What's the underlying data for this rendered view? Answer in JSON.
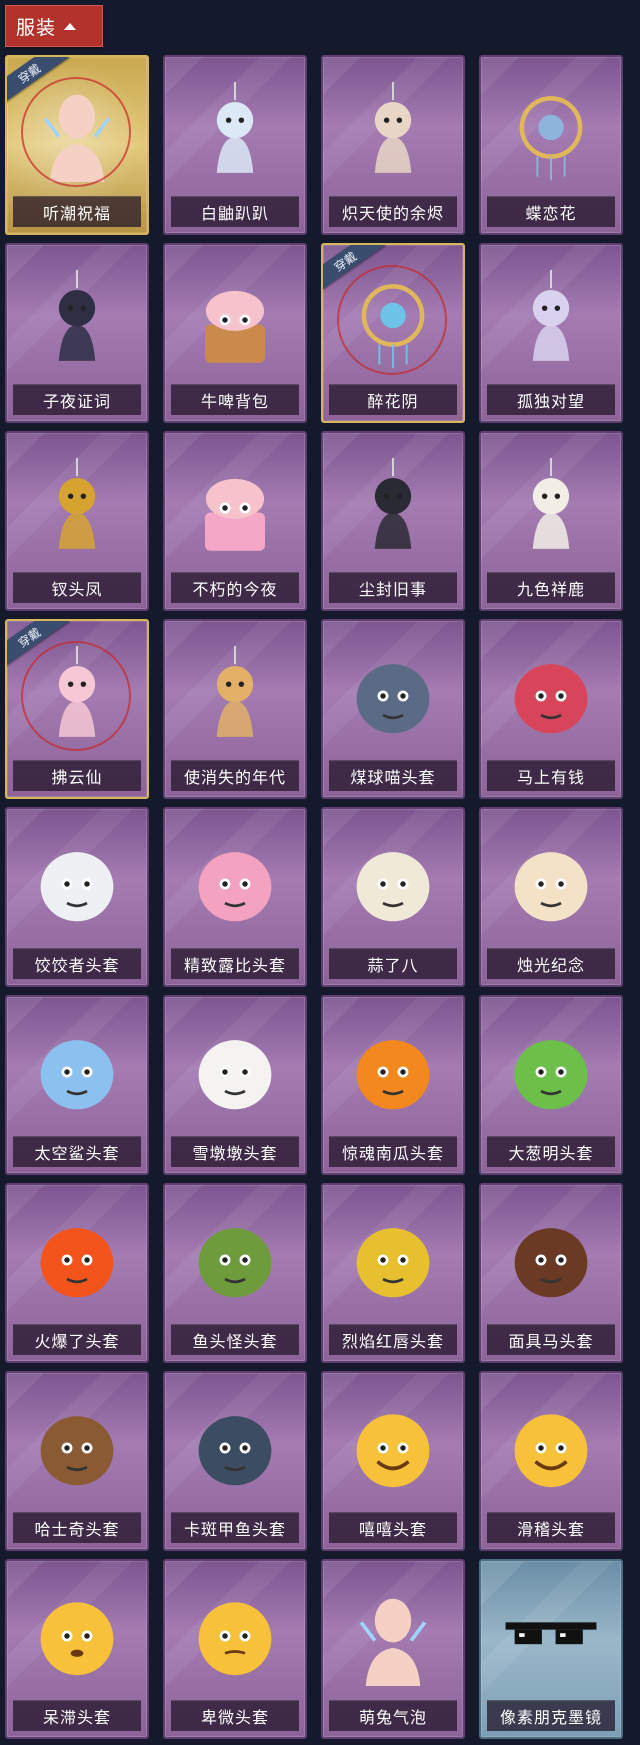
{
  "header": {
    "label": "服装"
  },
  "badge_text": "穿戴",
  "items": [
    {
      "name": "听潮祝福",
      "style": "gold",
      "equipped": true,
      "icon": "mannequin-wings-icon",
      "color": "#f4d1c4"
    },
    {
      "name": "白鼬趴趴",
      "style": "purple",
      "equipped": false,
      "icon": "white-weasel-pendant-icon",
      "color": "#dbe8f6"
    },
    {
      "name": "炽天使的余烬",
      "style": "purple",
      "equipped": false,
      "icon": "angel-doll-icon",
      "color": "#e9d6c6"
    },
    {
      "name": "蝶恋花",
      "style": "purple",
      "equipped": false,
      "icon": "butterfly-wreath-icon",
      "color": "#8fb4dc"
    },
    {
      "name": "子夜证词",
      "style": "purple",
      "equipped": false,
      "icon": "crow-doll-icon",
      "color": "#2e2f45"
    },
    {
      "name": "牛啤背包",
      "style": "purple",
      "equipped": false,
      "icon": "cow-beer-mug-icon",
      "color": "#c98a4b"
    },
    {
      "name": "醉花阴",
      "style": "purple",
      "equipped": true,
      "icon": "flower-dreamcatcher-icon",
      "color": "#6ec3e8"
    },
    {
      "name": "孤独对望",
      "style": "purple",
      "equipped": false,
      "icon": "moon-doll-icon",
      "color": "#d9d2ee"
    },
    {
      "name": "钗头凤",
      "style": "purple",
      "equipped": false,
      "icon": "phoenix-crown-doll-icon",
      "color": "#d6a331"
    },
    {
      "name": "不朽的今夜",
      "style": "purple",
      "equipped": false,
      "icon": "pink-fox-sundae-icon",
      "color": "#f4a7c7"
    },
    {
      "name": "尘封旧事",
      "style": "purple",
      "equipped": false,
      "icon": "gentleman-doll-icon",
      "color": "#2a2a35"
    },
    {
      "name": "九色祥鹿",
      "style": "purple",
      "equipped": false,
      "icon": "deer-charm-icon",
      "color": "#f2eee6"
    },
    {
      "name": "拂云仙",
      "style": "purple",
      "equipped": true,
      "icon": "cloud-fairy-charm-icon",
      "color": "#f6c7d4"
    },
    {
      "name": "使消失的年代",
      "style": "purple",
      "equipped": false,
      "icon": "sun-girl-doll-icon",
      "color": "#e2b067"
    },
    {
      "name": "煤球喵头套",
      "style": "purple",
      "equipped": false,
      "icon": "gray-cat-head-icon",
      "color": "#5b6b86"
    },
    {
      "name": "马上有钱",
      "style": "purple",
      "equipped": false,
      "icon": "red-horse-head-icon",
      "color": "#d8445a"
    },
    {
      "name": "饺饺者头套",
      "style": "purple",
      "equipped": false,
      "icon": "dumpling-head-icon",
      "color": "#eef0f4"
    },
    {
      "name": "精致露比头套",
      "style": "purple",
      "equipped": false,
      "icon": "pink-beaver-head-icon",
      "color": "#f3a2c0"
    },
    {
      "name": "蒜了八",
      "style": "purple",
      "equipped": false,
      "icon": "garlic-head-icon",
      "color": "#f1e9d8"
    },
    {
      "name": "烛光纪念",
      "style": "purple",
      "equipped": false,
      "icon": "candle-head-icon",
      "color": "#f4e2c6"
    },
    {
      "name": "太空鲨头套",
      "style": "purple",
      "equipped": false,
      "icon": "shark-head-icon",
      "color": "#8cc0ef"
    },
    {
      "name": "雪墩墩头套",
      "style": "purple",
      "equipped": false,
      "icon": "snowman-head-icon",
      "color": "#f5f3f2"
    },
    {
      "name": "惊魂南瓜头套",
      "style": "purple",
      "equipped": false,
      "icon": "pumpkin-head-icon",
      "color": "#f2881e"
    },
    {
      "name": "大葱明头套",
      "style": "purple",
      "equipped": false,
      "icon": "scallion-head-icon",
      "color": "#6cc04a"
    },
    {
      "name": "火爆了头套",
      "style": "purple",
      "equipped": false,
      "icon": "fire-head-icon",
      "color": "#f2541c"
    },
    {
      "name": "鱼头怪头套",
      "style": "purple",
      "equipped": false,
      "icon": "fish-head-icon",
      "color": "#6e9b3c"
    },
    {
      "name": "烈焰红唇头套",
      "style": "purple",
      "equipped": false,
      "icon": "yellow-mouse-head-icon",
      "color": "#e7c02f"
    },
    {
      "name": "面具马头套",
      "style": "purple",
      "equipped": false,
      "icon": "horse-mask-icon",
      "color": "#6a3a24"
    },
    {
      "name": "哈士奇头套",
      "style": "purple",
      "equipped": false,
      "icon": "husky-head-icon",
      "color": "#8a5a34"
    },
    {
      "name": "卡斑甲鱼头套",
      "style": "purple",
      "equipped": false,
      "icon": "whale-head-icon",
      "color": "#3c4c63"
    },
    {
      "name": "嘻嘻头套",
      "style": "purple",
      "equipped": false,
      "icon": "grin-emoji-head-icon",
      "color": "#f7c23a"
    },
    {
      "name": "滑稽头套",
      "style": "purple",
      "equipped": false,
      "icon": "smirk-emoji-head-icon",
      "color": "#f7c23a"
    },
    {
      "name": "呆滞头套",
      "style": "purple",
      "equipped": false,
      "icon": "dazed-emoji-head-icon",
      "color": "#f7c23a"
    },
    {
      "name": "卑微头套",
      "style": "purple",
      "equipped": false,
      "icon": "shy-emoji-head-icon",
      "color": "#f7c23a"
    },
    {
      "name": "萌兔气泡",
      "style": "purple",
      "equipped": false,
      "icon": "mannequin-bubble-icon",
      "color": "#f4d1c4"
    },
    {
      "name": "像素朋克墨镜",
      "style": "blue",
      "equipped": false,
      "icon": "pixel-sunglasses-icon",
      "color": "#111111"
    }
  ]
}
